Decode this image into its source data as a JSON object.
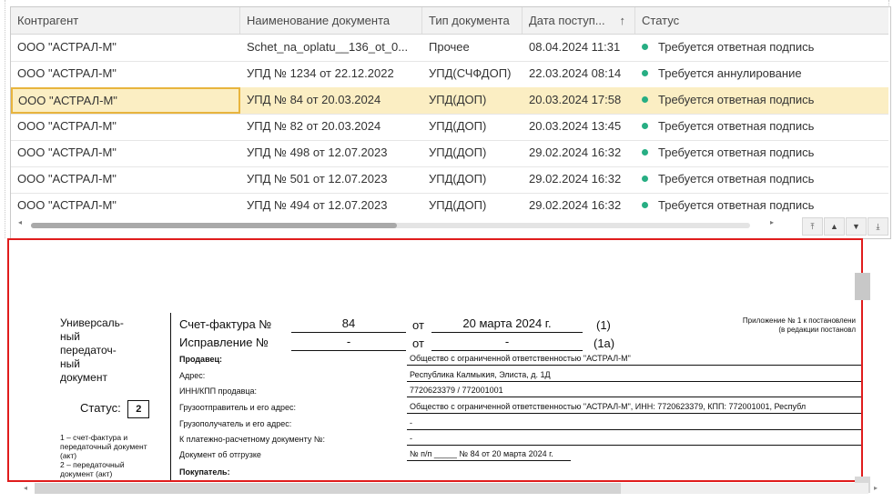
{
  "table": {
    "columns": [
      "Контрагент",
      "Наименование документа",
      "Тип документа",
      "Дата поступ...",
      "Статус"
    ],
    "sort_indicator": "↑",
    "rows": [
      {
        "counterparty": "ООО \"АСТРАЛ-М\"",
        "name": "Schet_na_oplatu__136_ot_0...",
        "type": "Прочее",
        "date": "08.04.2024 11:31",
        "status": "Требуется ответная подпись"
      },
      {
        "counterparty": "ООО \"АСТРАЛ-М\"",
        "name": "УПД № 1234 от 22.12.2022",
        "type": "УПД(СЧФДОП)",
        "date": "22.03.2024 08:14",
        "status": "Требуется аннулирование"
      },
      {
        "counterparty": "ООО \"АСТРАЛ-М\"",
        "name": "УПД № 84 от 20.03.2024",
        "type": "УПД(ДОП)",
        "date": "20.03.2024 17:58",
        "status": "Требуется ответная подпись"
      },
      {
        "counterparty": "ООО \"АСТРАЛ-М\"",
        "name": "УПД № 82 от 20.03.2024",
        "type": "УПД(ДОП)",
        "date": "20.03.2024 13:45",
        "status": "Требуется ответная подпись"
      },
      {
        "counterparty": "ООО \"АСТРАЛ-М\"",
        "name": "УПД № 498 от 12.07.2023",
        "type": "УПД(ДОП)",
        "date": "29.02.2024 16:32",
        "status": "Требуется ответная подпись"
      },
      {
        "counterparty": "ООО \"АСТРАЛ-М\"",
        "name": "УПД № 501 от 12.07.2023",
        "type": "УПД(ДОП)",
        "date": "29.02.2024 16:32",
        "status": "Требуется ответная подпись"
      },
      {
        "counterparty": "ООО \"АСТРАЛ-М\"",
        "name": "УПД № 494 от 12.07.2023",
        "type": "УПД(ДОП)",
        "date": "29.02.2024 16:32",
        "status": "Требуется ответная подпись"
      }
    ],
    "selected_row": 2,
    "status_color": "#27ae83",
    "selected_color": "#fbeec3"
  },
  "nav_buttons": [
    "first-icon",
    "up-icon",
    "down-icon",
    "last-icon"
  ],
  "document": {
    "left_title": "Универсаль-\nный\nпередаточ-\nный\nдокумент",
    "status_label": "Статус:",
    "status_value": "2",
    "status_note": "1 – счет-фактура и\nпередаточный документ\n(акт)\n2 – передаточный\nдокумент (акт)",
    "invoice_label": "Счет-фактура №",
    "invoice_number": "84",
    "invoice_from": "от",
    "invoice_date": "20 марта 2024 г.",
    "invoice_ref": "(1)",
    "correction_label": "Исправление №",
    "correction_number": "-",
    "correction_from": "от",
    "correction_date": "-",
    "correction_ref": "(1а)",
    "annex_line1": "Приложение № 1 к постановлени",
    "annex_line2": "(в редакции постановл",
    "fields": [
      {
        "label": "Продавец:",
        "value": "Общество с ограниченной ответственностью \"АСТРАЛ-М\"",
        "bold": true
      },
      {
        "label": "Адрес:",
        "value": "Республика Калмыкия, Элиста, д. 1Д",
        "bold": false
      },
      {
        "label": "ИНН/КПП продавца:",
        "value": "7720623379 / 772001001",
        "bold": false
      },
      {
        "label": "Грузоотправитель и его адрес:",
        "value": "Общество с ограниченной ответственностью \"АСТРАЛ-М\", ИНН: 7720623379, КПП: 772001001, Республ",
        "bold": false
      },
      {
        "label": "Грузополучатель и его адрес:",
        "value": "-",
        "bold": false
      },
      {
        "label": "К платежно-расчетному документу №:",
        "value": "-",
        "bold": false
      },
      {
        "label": "Документ об отгрузке",
        "value": "№ п/п _____ № 84 от 20 марта 2024 г.",
        "bold": false
      },
      {
        "label": "Покупатель:",
        "value": "",
        "bold": true
      }
    ]
  }
}
